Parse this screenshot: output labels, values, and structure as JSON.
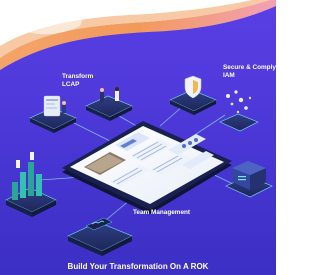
{
  "labels": {
    "transform_line1": "Transform",
    "transform_line2": "LCAP",
    "secure_line1": "Secure & Comply",
    "secure_line2": "IAM",
    "team": "Team Management"
  },
  "headline": "Build Your Transformation On A ROK",
  "colors": {
    "background_top": "#4f3ce0",
    "background_bottom": "#3a2fc4",
    "wave_orange": "#f29a5c",
    "wave_pink": "#f3a0b4",
    "platform": "#24306a",
    "tablet_frame": "#1a2150",
    "accent_cyan": "#7be3ff"
  }
}
